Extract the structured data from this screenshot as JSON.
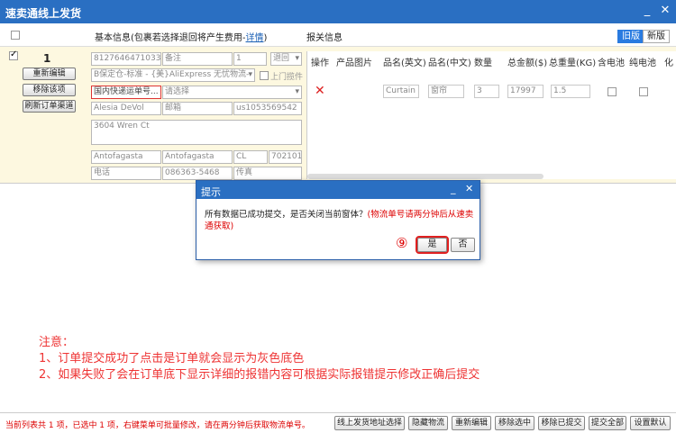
{
  "window": {
    "title": "速卖通线上发货",
    "min": "_",
    "close": "✕"
  },
  "header": {
    "basic_info": "基本信息(包裹若选择退回将产生费用-",
    "details_link": "详情",
    "basic_info_end": ")",
    "declare_info": "报关信息",
    "old_version": "旧版",
    "new_version": "新版"
  },
  "order": {
    "row_number": "1",
    "buttons": {
      "re_edit": "重新编辑",
      "remove": "移除该项",
      "refresh": "刷新订单渠道"
    },
    "fields": {
      "order_id": "8127646471033(",
      "remark": "备注",
      "qty": "1",
      "return": "退回",
      "warehouse": "B保定仓-标准 - {美}AliExpress 无忧物流-",
      "pickup_label": "上门揽件",
      "logistics": "国内快递运单号...",
      "select_placeholder": "请选择",
      "name": "Alesia DeVol",
      "email_label": "邮箱",
      "user_id": "us1053569542",
      "address": "3604 Wren Ct",
      "city": "Antofagasta",
      "province": "Antofagasta",
      "country": "CL",
      "zip": "702101",
      "phone_label": "电话",
      "phone": "086363-5468",
      "fax_label": "传真"
    }
  },
  "table": {
    "headers": [
      "操作",
      "产品图片",
      "品名(英文)",
      "品名(中文)",
      "数量",
      "总金额($)",
      "总重量(KG)",
      "含电池",
      "纯电池",
      "化"
    ],
    "row": {
      "name_en": "Curtain",
      "name_cn": "窗帘",
      "qty": "3",
      "amount": "17997",
      "weight": "1.5"
    }
  },
  "dialog": {
    "title": "提示",
    "message": "所有数据已成功提交，是否关闭当前窗体？",
    "hint": "(物流单号请两分钟后从速卖通获取)",
    "step": "⑨",
    "yes": "是",
    "no": "否"
  },
  "notes": {
    "title": "注意：",
    "line1": "1、订单提交成功了点击是订单就会显示为灰色底色",
    "line2": "2、如果失败了会在订单底下显示详细的报错内容可根据实际报错提示修改正确后提交"
  },
  "footer": {
    "status": "当前列表共 1 项，已选中 1 项，右键菜单可批量修改，请在两分钟后获取物流单号。",
    "buttons": [
      "线上发货地址选择",
      "隐藏物流",
      "重新编辑",
      "移除选中",
      "移除已提交",
      "提交全部",
      "设置默认"
    ]
  },
  "colors": {
    "accent": "#2a6fc2",
    "warning": "#e33333",
    "row_bg": "#fdf8e0"
  }
}
